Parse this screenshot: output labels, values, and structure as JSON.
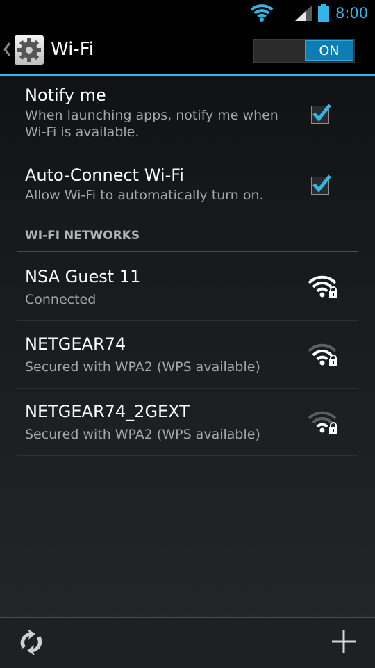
{
  "status_bar": {
    "time": "8:00"
  },
  "action_bar": {
    "title": "Wi-Fi",
    "toggle_label": "ON"
  },
  "preferences": [
    {
      "title": "Notify me",
      "summary_line1": "When launching apps, notify me when",
      "summary_line2": "Wi-Fi is available.",
      "checked": true
    },
    {
      "title": "Auto-Connect Wi-Fi",
      "summary_line1": "Allow Wi-Fi to automatically turn on.",
      "checked": true
    }
  ],
  "section_header": "WI-FI NETWORKS",
  "networks": [
    {
      "name": "NSA Guest 11",
      "status": "Connected",
      "icon": "wifi-locked-icon"
    },
    {
      "name": "NETGEAR74",
      "status": "Secured with WPA2 (WPS available)",
      "icon": "wifi-locked-icon"
    },
    {
      "name": "NETGEAR74_2GEXT",
      "status": "Secured with WPA2 (WPS available)",
      "icon": "wifi-locked-icon"
    }
  ],
  "bottom_bar": {
    "left_icon": "scan-icon",
    "right_icon": "add-network-icon"
  },
  "colors": {
    "accent": "#33b5e5",
    "toggle_on": "#0e7db4"
  }
}
